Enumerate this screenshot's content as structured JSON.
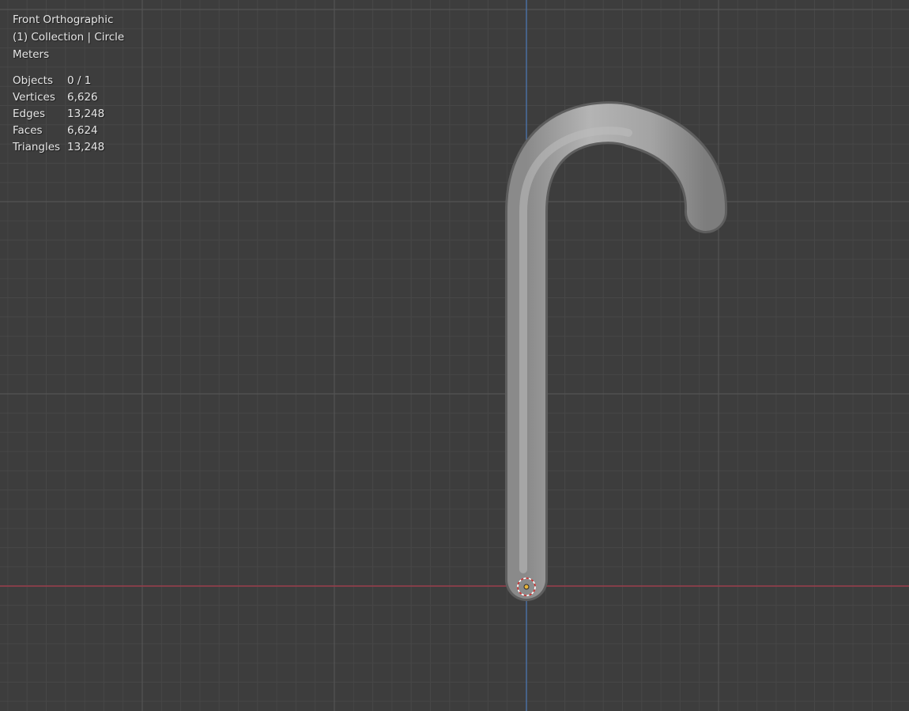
{
  "viewport": {
    "view_name": "Front Orthographic",
    "collection_info": "(1) Collection | Circle",
    "units": "Meters",
    "background_color": "#3d3d3d",
    "grid_minor_color": "#474747",
    "grid_major_color": "#545454",
    "x_axis_color": "#9a3c4a",
    "z_axis_color": "#4a78b8",
    "mesh_color": "#a9a9a9"
  },
  "stats": [
    {
      "label": "Objects",
      "value": "0 / 1"
    },
    {
      "label": "Vertices",
      "value": "6,626"
    },
    {
      "label": "Edges",
      "value": "13,248"
    },
    {
      "label": "Faces",
      "value": "6,624"
    },
    {
      "label": "Triangles",
      "value": "13,248"
    }
  ],
  "icons": {
    "origin": "object-origin-icon",
    "cursor": "3d-cursor-icon"
  }
}
